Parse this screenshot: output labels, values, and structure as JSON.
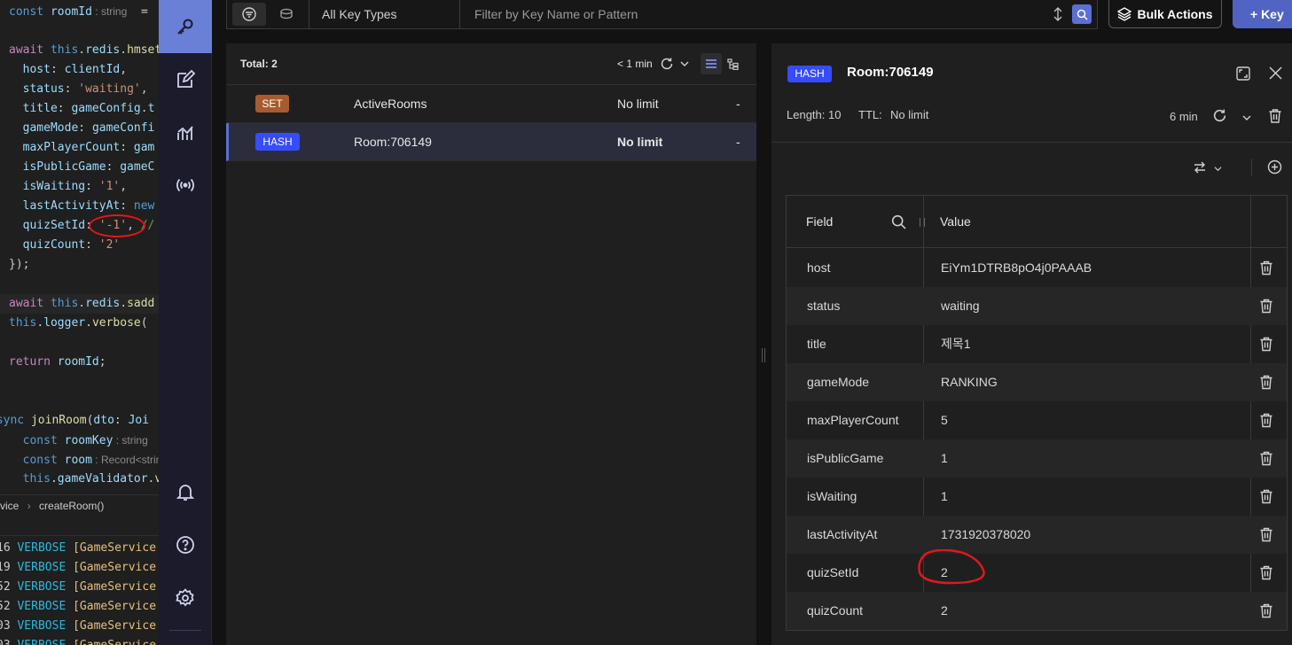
{
  "editor": {
    "lines": [
      {
        "parts": [
          [
            "kwb",
            "const "
          ],
          [
            "var",
            "roomId"
          ],
          [
            "hint",
            " : string"
          ],
          [
            "punc",
            "  ="
          ]
        ]
      },
      {
        "parts": [
          [
            "punc",
            ""
          ]
        ]
      },
      {
        "parts": [
          [
            "kw",
            "await "
          ],
          [
            "kwb",
            "this"
          ],
          [
            "punc",
            "."
          ],
          [
            "var",
            "redis"
          ],
          [
            "punc",
            "."
          ],
          [
            "fn",
            "hmset"
          ]
        ]
      },
      {
        "parts": [
          [
            "var",
            "  host"
          ],
          [
            "punc",
            ": "
          ],
          [
            "var",
            "clientId"
          ],
          [
            "punc",
            ","
          ]
        ]
      },
      {
        "parts": [
          [
            "var",
            "  status"
          ],
          [
            "punc",
            ": "
          ],
          [
            "str",
            "'waiting'"
          ],
          [
            "punc",
            ","
          ]
        ]
      },
      {
        "parts": [
          [
            "var",
            "  title"
          ],
          [
            "punc",
            ": "
          ],
          [
            "var",
            "gameConfig"
          ],
          [
            "punc",
            "."
          ],
          [
            "var",
            "t"
          ]
        ]
      },
      {
        "parts": [
          [
            "var",
            "  gameMode"
          ],
          [
            "punc",
            ": "
          ],
          [
            "var",
            "gameConfi"
          ]
        ]
      },
      {
        "parts": [
          [
            "var",
            "  maxPlayerCount"
          ],
          [
            "punc",
            ": "
          ],
          [
            "var",
            "gam"
          ]
        ]
      },
      {
        "parts": [
          [
            "var",
            "  isPublicGame"
          ],
          [
            "punc",
            ": "
          ],
          [
            "var",
            "gameC"
          ]
        ]
      },
      {
        "parts": [
          [
            "var",
            "  isWaiting"
          ],
          [
            "punc",
            ": "
          ],
          [
            "str",
            "'1'"
          ],
          [
            "punc",
            ","
          ]
        ]
      },
      {
        "parts": [
          [
            "var",
            "  lastActivityAt"
          ],
          [
            "punc",
            ": "
          ],
          [
            "kwb",
            "new"
          ]
        ]
      },
      {
        "parts": [
          [
            "var",
            "  quizSetId"
          ],
          [
            "punc",
            ": "
          ],
          [
            "str",
            "'-1'"
          ],
          [
            "punc",
            ", "
          ],
          [
            "cmt",
            "//"
          ]
        ]
      },
      {
        "parts": [
          [
            "var",
            "  quizCount"
          ],
          [
            "punc",
            ": "
          ],
          [
            "str",
            "'2'"
          ]
        ]
      },
      {
        "parts": [
          [
            "punc",
            "});"
          ]
        ]
      },
      {
        "parts": [
          [
            "punc",
            ""
          ]
        ]
      },
      {
        "parts": [
          [
            "kw",
            "await "
          ],
          [
            "kwb",
            "this"
          ],
          [
            "punc",
            "."
          ],
          [
            "var",
            "redis"
          ],
          [
            "punc",
            "."
          ],
          [
            "fn",
            "sadd"
          ]
        ]
      },
      {
        "parts": [
          [
            "kwb",
            "this"
          ],
          [
            "punc",
            "."
          ],
          [
            "var",
            "logger"
          ],
          [
            "punc",
            "."
          ],
          [
            "fn",
            "verbose"
          ],
          [
            "punc",
            "( "
          ]
        ]
      },
      {
        "parts": [
          [
            "punc",
            ""
          ]
        ]
      },
      {
        "parts": [
          [
            "kw",
            "return "
          ],
          [
            "var",
            "roomId"
          ],
          [
            "punc",
            ";"
          ]
        ]
      },
      {
        "parts": [
          [
            "punc",
            ""
          ]
        ]
      },
      {
        "parts": [
          [
            "punc",
            ""
          ]
        ]
      },
      {
        "parts": [
          [
            "kwb",
            "async "
          ],
          [
            "fn",
            "joinRoom"
          ],
          [
            "punc",
            "("
          ],
          [
            "var",
            "dto"
          ],
          [
            "punc",
            ": "
          ],
          [
            "var",
            "Joi"
          ]
        ]
      },
      {
        "parts": [
          [
            "kwb",
            "  const "
          ],
          [
            "var",
            "roomKey"
          ],
          [
            "hint",
            " : string"
          ]
        ]
      },
      {
        "parts": [
          [
            "kwb",
            "  const "
          ],
          [
            "var",
            "room"
          ],
          [
            "hint",
            " : Record<strin"
          ]
        ]
      },
      {
        "parts": [
          [
            "kwb",
            "  this"
          ],
          [
            "punc",
            "."
          ],
          [
            "var",
            "gameValidator"
          ],
          [
            "punc",
            "."
          ],
          [
            "fn",
            "va"
          ]
        ]
      }
    ],
    "breadcrumb": [
      "vice",
      "createRoom()"
    ],
    "terminal": [
      {
        "num": "16",
        "level": "VERBOSE",
        "ctx": "[GameService"
      },
      {
        "num": "19",
        "level": "VERBOSE",
        "ctx": "[GameService"
      },
      {
        "num": "52",
        "level": "VERBOSE",
        "ctx": "[GameService"
      },
      {
        "num": "52",
        "level": "VERBOSE",
        "ctx": "[GameService"
      },
      {
        "num": "03",
        "level": "VERBOSE",
        "ctx": "[GameService"
      },
      {
        "num": "03",
        "level": "VERBOSE",
        "ctx": "[GameService"
      }
    ]
  },
  "nav": {
    "items": [
      "browser-icon",
      "workbench-icon",
      "analytics-icon",
      "pubsub-icon",
      "notifications-icon",
      "help-icon",
      "settings-icon"
    ]
  },
  "toolbar": {
    "type_select": "All Key Types",
    "search_placeholder": "Filter by Key Name or Pattern",
    "bulk_actions": "Bulk Actions",
    "add_key": "+ Key"
  },
  "keylist": {
    "total": "Total: 2",
    "refreshed": "< 1 min",
    "keys": [
      {
        "type": "SET",
        "type_color": "#a75b2e",
        "name": "ActiveRooms",
        "ttl": "No limit",
        "size": "-",
        "selected": false
      },
      {
        "type": "HASH",
        "type_color": "#364cff",
        "name": "Room:706149",
        "ttl": "No limit",
        "size": "-",
        "selected": true
      }
    ]
  },
  "details": {
    "type": "HASH",
    "key": "Room:706149",
    "length": "Length: 10",
    "ttl_label": "TTL:",
    "ttl_value": "No limit",
    "refreshed": "6 min",
    "columns": {
      "field": "Field",
      "value": "Value"
    },
    "rows": [
      {
        "field": "host",
        "value": "EiYm1DTRB8pO4j0PAAAB"
      },
      {
        "field": "status",
        "value": "waiting"
      },
      {
        "field": "title",
        "value": "제목1"
      },
      {
        "field": "gameMode",
        "value": "RANKING"
      },
      {
        "field": "maxPlayerCount",
        "value": "5"
      },
      {
        "field": "isPublicGame",
        "value": "1"
      },
      {
        "field": "isWaiting",
        "value": "1"
      },
      {
        "field": "lastActivityAt",
        "value": "1731920378020"
      },
      {
        "field": "quizSetId",
        "value": "2"
      },
      {
        "field": "quizCount",
        "value": "2"
      }
    ]
  },
  "colors": {
    "accent": "#5164c3",
    "nav_active": "#6a7fd6",
    "annotation": "#e0181b"
  }
}
